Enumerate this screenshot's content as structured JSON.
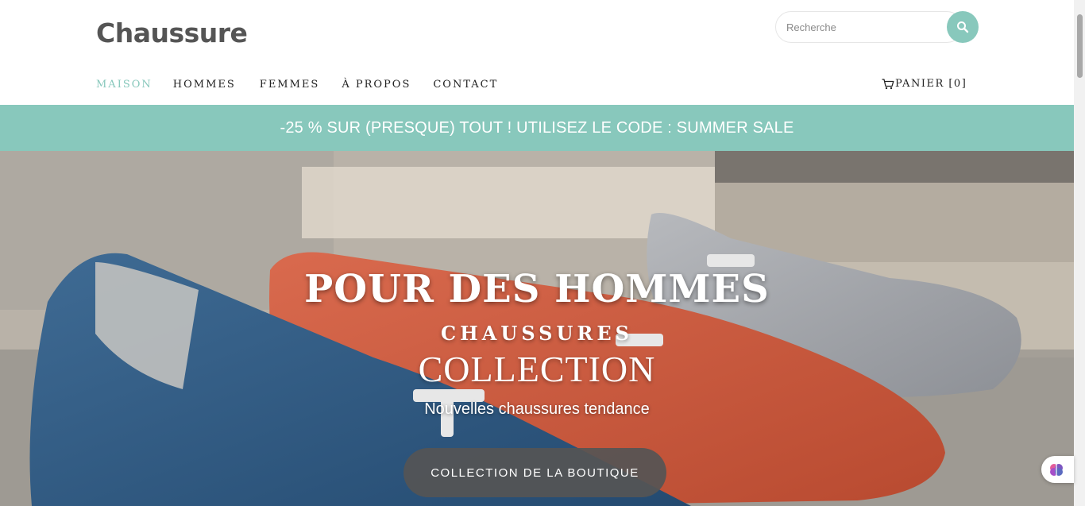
{
  "header": {
    "brand": "Chaussure",
    "search": {
      "placeholder": "Recherche",
      "value": ""
    }
  },
  "nav": {
    "items": [
      {
        "label": "MAISON",
        "active": true
      },
      {
        "label": "HOMMES"
      },
      {
        "label": "FEMMES"
      },
      {
        "label": "À PROPOS"
      },
      {
        "label": "CONTACT"
      }
    ],
    "cart_label": "PANIER [0]"
  },
  "promo": {
    "text": "-25 % SUR (PRESQUE) TOUT ! UTILISEZ LE CODE : SUMMER SALE"
  },
  "hero": {
    "title": "POUR DES HOMMES",
    "subtitle": "CHAUSSURES",
    "collection": "COLLECTION",
    "tagline": "Nouvelles chaussures tendance",
    "button": "COLLECTION DE LA BOUTIQUE"
  },
  "colors": {
    "accent": "#88c8bc",
    "brand_text": "#555555",
    "button_bg": "#555555"
  },
  "icons": {
    "search": "search-icon",
    "cart": "cart-icon",
    "widget": "brain-icon"
  }
}
